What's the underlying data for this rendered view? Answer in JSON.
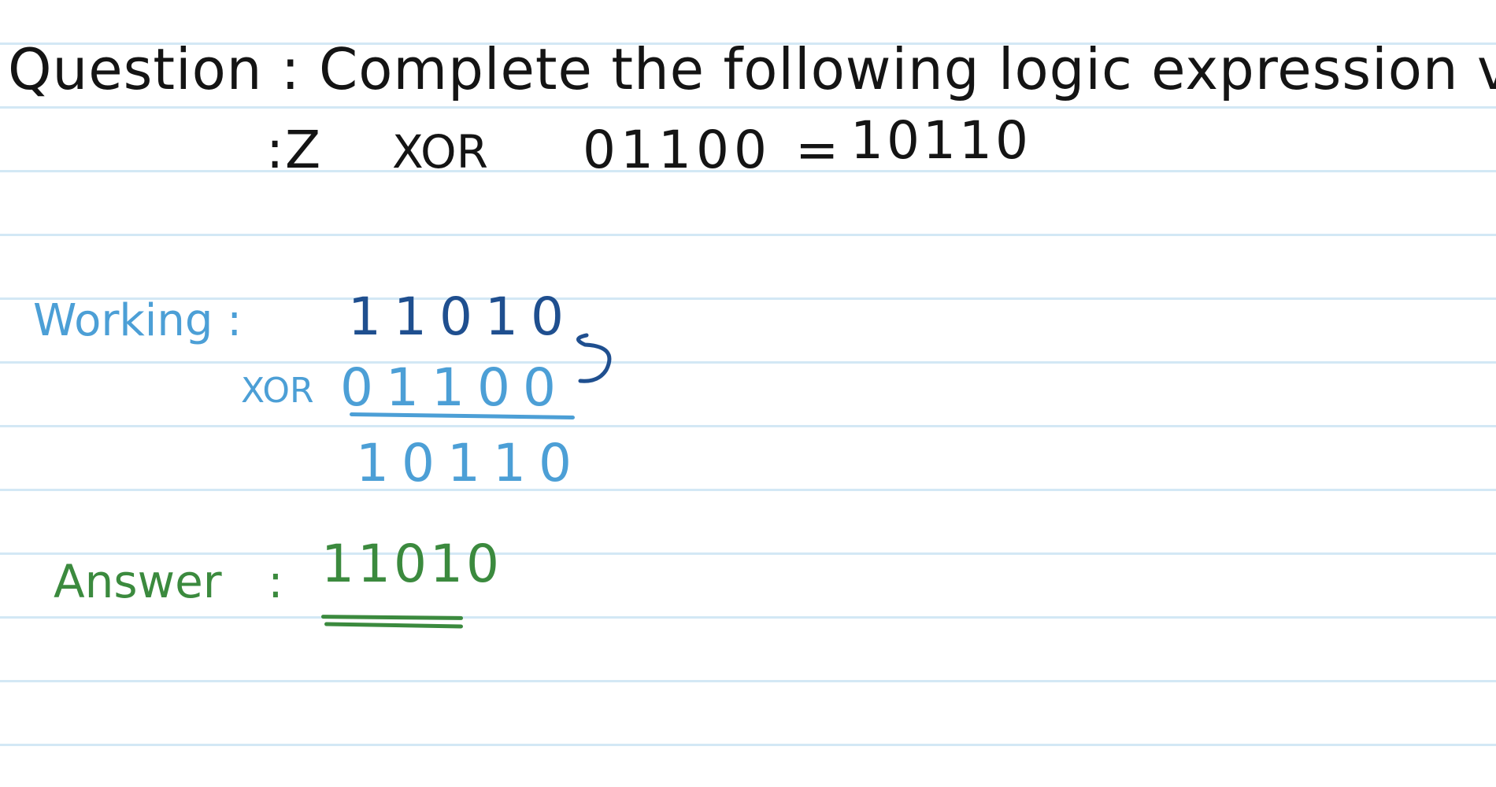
{
  "question": {
    "label": "Question",
    "separator": ":",
    "text": "Complete the following logic expression value Z",
    "expression": {
      "prefix": ":",
      "variable": "Z",
      "operator": "XOR",
      "operand": "01100",
      "equals": "=",
      "result": "10110"
    }
  },
  "working": {
    "label": "Working",
    "separator": ":",
    "top_row": "11010",
    "operator": "XOR",
    "operand": "01100",
    "result": "10110"
  },
  "answer": {
    "label": "Answer",
    "separator": ":",
    "value": "11010"
  },
  "colors": {
    "question_ink": "#141414",
    "working_ink": "#4c9fd6",
    "working_dark_ink": "#1f4f8f",
    "answer_ink": "#3b8a3e",
    "rule_line": "#d3e8f5"
  }
}
